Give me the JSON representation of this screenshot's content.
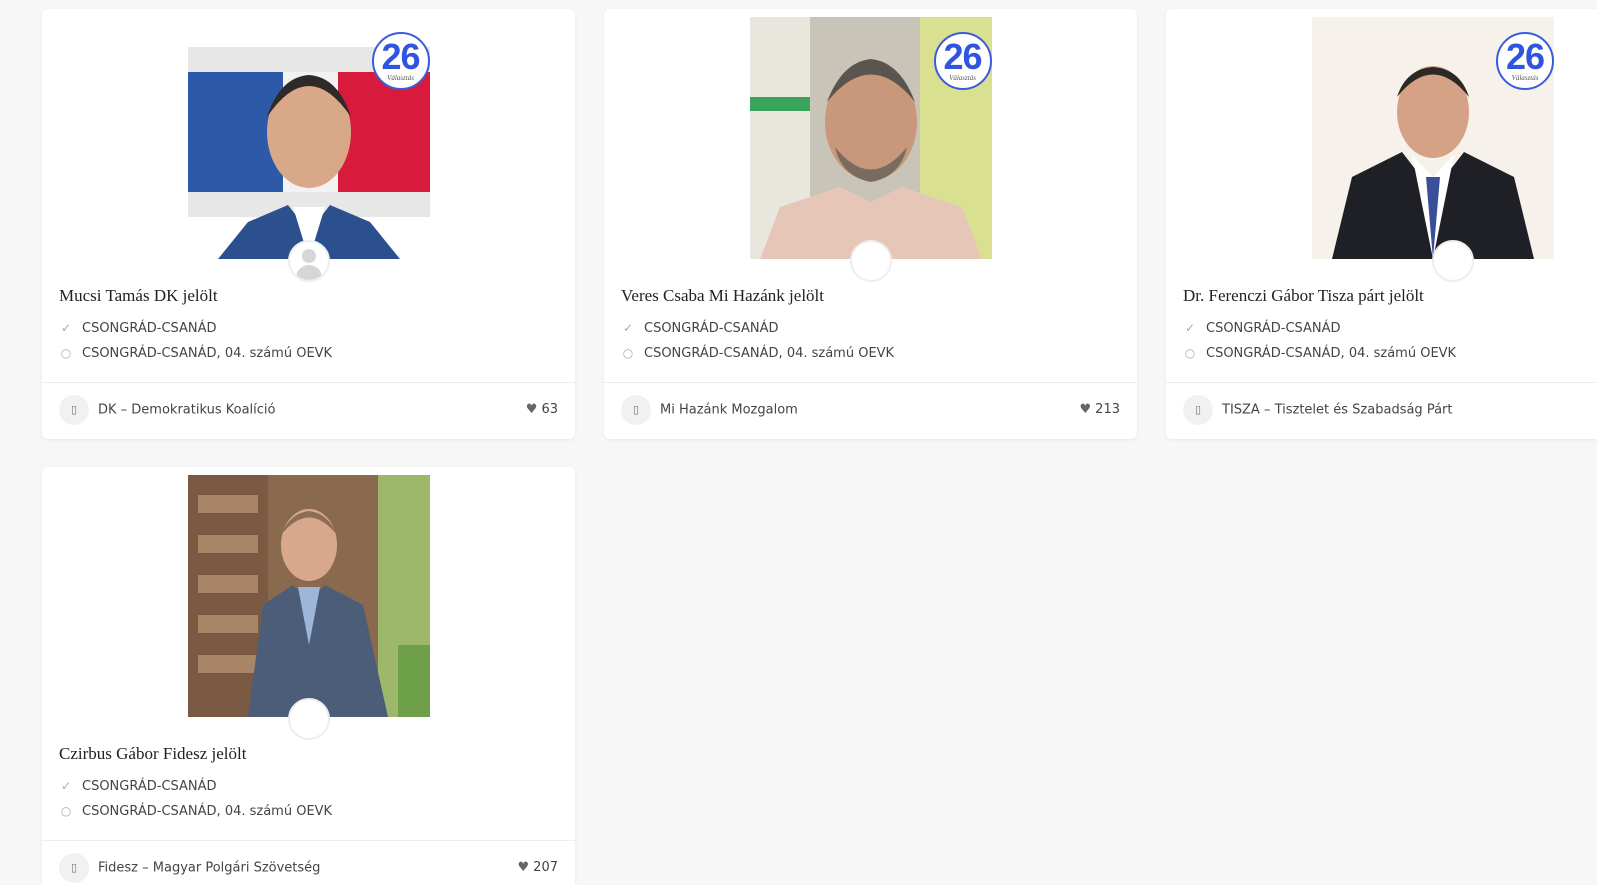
{
  "badge": {
    "number": "26",
    "subtitle": "Választás"
  },
  "cards": [
    {
      "name": "Mucsi Tamás DK jelölt",
      "county": "CSONGRÁD-CSANÁD",
      "district": "CSONGRÁD-CSANÁD, 04. számú OEVK",
      "party": "DK – Demokratikus Koalíció",
      "likes": "63"
    },
    {
      "name": "Veres Csaba Mi Hazánk jelölt",
      "county": "CSONGRÁD-CSANÁD",
      "district": "CSONGRÁD-CSANÁD, 04. számú OEVK",
      "party": "Mi Hazánk Mozgalom",
      "likes": "213"
    },
    {
      "name": "Dr. Ferenczi Gábor Tisza párt jelölt",
      "county": "CSONGRÁD-CSANÁD",
      "district": "CSONGRÁD-CSANÁD, 04. számú OEVK",
      "party": "TISZA – Tisztelet és Szabadság Párt",
      "likes": ""
    },
    {
      "name": "Czirbus Gábor Fidesz jelölt",
      "county": "CSONGRÁD-CSANÁD",
      "district": "CSONGRÁD-CSANÁD, 04. számú OEVK",
      "party": "Fidesz – Magyar Polgári Szövetség",
      "likes": "207"
    }
  ],
  "icons": {
    "verified": "check-circle-icon",
    "location": "map-pin-icon",
    "party": "bookmark-icon",
    "likes": "heart-icon"
  },
  "colors": {
    "badge_blue": "#2f55e0",
    "page_bg": "#f7f7f7",
    "card_bg": "#ffffff"
  }
}
